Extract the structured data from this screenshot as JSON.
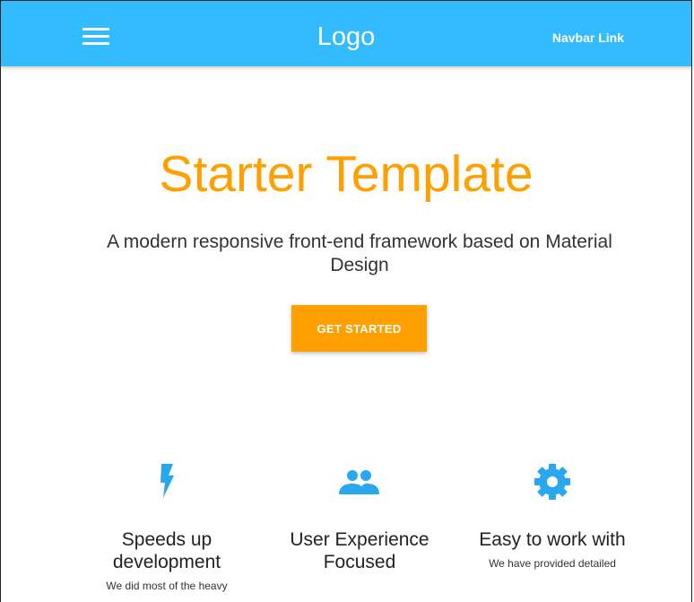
{
  "navbar": {
    "logo": "Logo",
    "link": "Navbar Link",
    "color": "#33bbff"
  },
  "hero": {
    "title": "Starter Template",
    "subtitle": "A modern responsive front-end framework based on Material Design",
    "button_label": "GET STARTED",
    "accent_color": "#ffa000"
  },
  "features": [
    {
      "icon": "bolt-icon",
      "title": "Speeds up development",
      "text": "We did most of the heavy"
    },
    {
      "icon": "group-icon",
      "title": "User Experience Focused",
      "text": ""
    },
    {
      "icon": "gear-icon",
      "title": "Easy to work with",
      "text": "We have provided detailed"
    }
  ]
}
